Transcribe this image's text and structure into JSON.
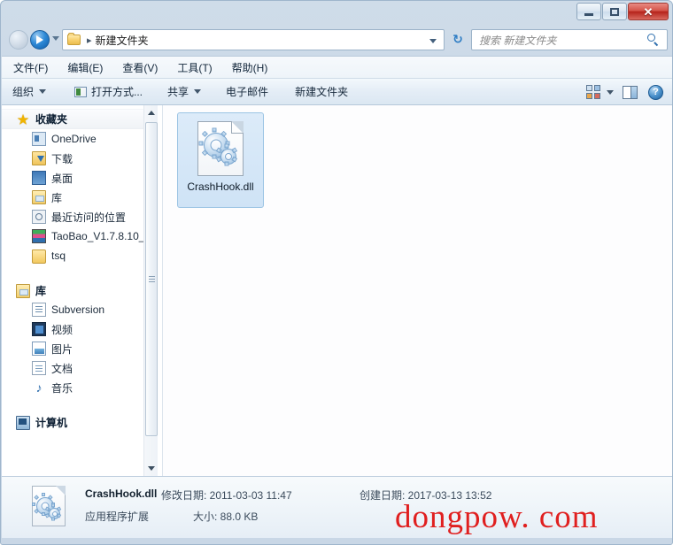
{
  "window": {
    "controls": {
      "minimize_label": "—",
      "maximize_label": "□",
      "close_label": "✕"
    }
  },
  "nav": {
    "back_title": "后退",
    "forward_title": "前进",
    "history_title": "历史记录",
    "breadcrumb_separator": "▸",
    "breadcrumb": "新建文件夹",
    "refresh_label": "↻",
    "address_dropdown_title": "地址下拉"
  },
  "search": {
    "placeholder": "搜索 新建文件夹"
  },
  "menubar": {
    "items": [
      {
        "label": "文件(F)"
      },
      {
        "label": "编辑(E)"
      },
      {
        "label": "查看(V)"
      },
      {
        "label": "工具(T)"
      },
      {
        "label": "帮助(H)"
      }
    ]
  },
  "toolbar": {
    "organize_label": "组织",
    "open_with_label": "打开方式...",
    "share_label": "共享",
    "email_label": "电子邮件",
    "new_folder_label": "新建文件夹",
    "help_label": "?"
  },
  "sidebar": {
    "groups": [
      {
        "header": "收藏夹",
        "icon": "star-icon",
        "highlighted": true,
        "items": [
          {
            "label": "OneDrive",
            "icon": "onedrive-icon"
          },
          {
            "label": "下载",
            "icon": "download-icon"
          },
          {
            "label": "桌面",
            "icon": "desktop-icon"
          },
          {
            "label": "库",
            "icon": "library-icon"
          },
          {
            "label": "最近访问的位置",
            "icon": "recent-places-icon"
          },
          {
            "label": "TaoBao_V1.7.8.10_",
            "icon": "taobao-icon"
          },
          {
            "label": "tsq",
            "icon": "folder-icon"
          }
        ]
      },
      {
        "header": "库",
        "icon": "library-icon",
        "highlighted": false,
        "items": [
          {
            "label": "Subversion",
            "icon": "subversion-icon"
          },
          {
            "label": "视频",
            "icon": "video-icon"
          },
          {
            "label": "图片",
            "icon": "picture-icon"
          },
          {
            "label": "文档",
            "icon": "document-icon"
          },
          {
            "label": "音乐",
            "icon": "music-icon"
          }
        ]
      },
      {
        "header": "计算机",
        "icon": "computer-icon",
        "highlighted": false,
        "items": []
      }
    ]
  },
  "content": {
    "files": [
      {
        "name": "CrashHook.dll",
        "icon": "dll-gear-icon",
        "selected": true
      }
    ]
  },
  "status": {
    "file_name": "CrashHook.dll",
    "file_type": "应用程序扩展",
    "modified_label": "修改日期: 2011-03-03 11:47",
    "size_label": "大小: 88.0 KB",
    "created_label": "创建日期: 2017-03-13 13:52",
    "watermark": "dongpow. com"
  },
  "colors": {
    "frame": "#c9d7e6",
    "selection": "#cfe3f6",
    "selection_border": "#9cc4e4",
    "close_button": "#c0392b",
    "watermark": "#e01f1f",
    "content_bg": "#fdfdfe"
  }
}
